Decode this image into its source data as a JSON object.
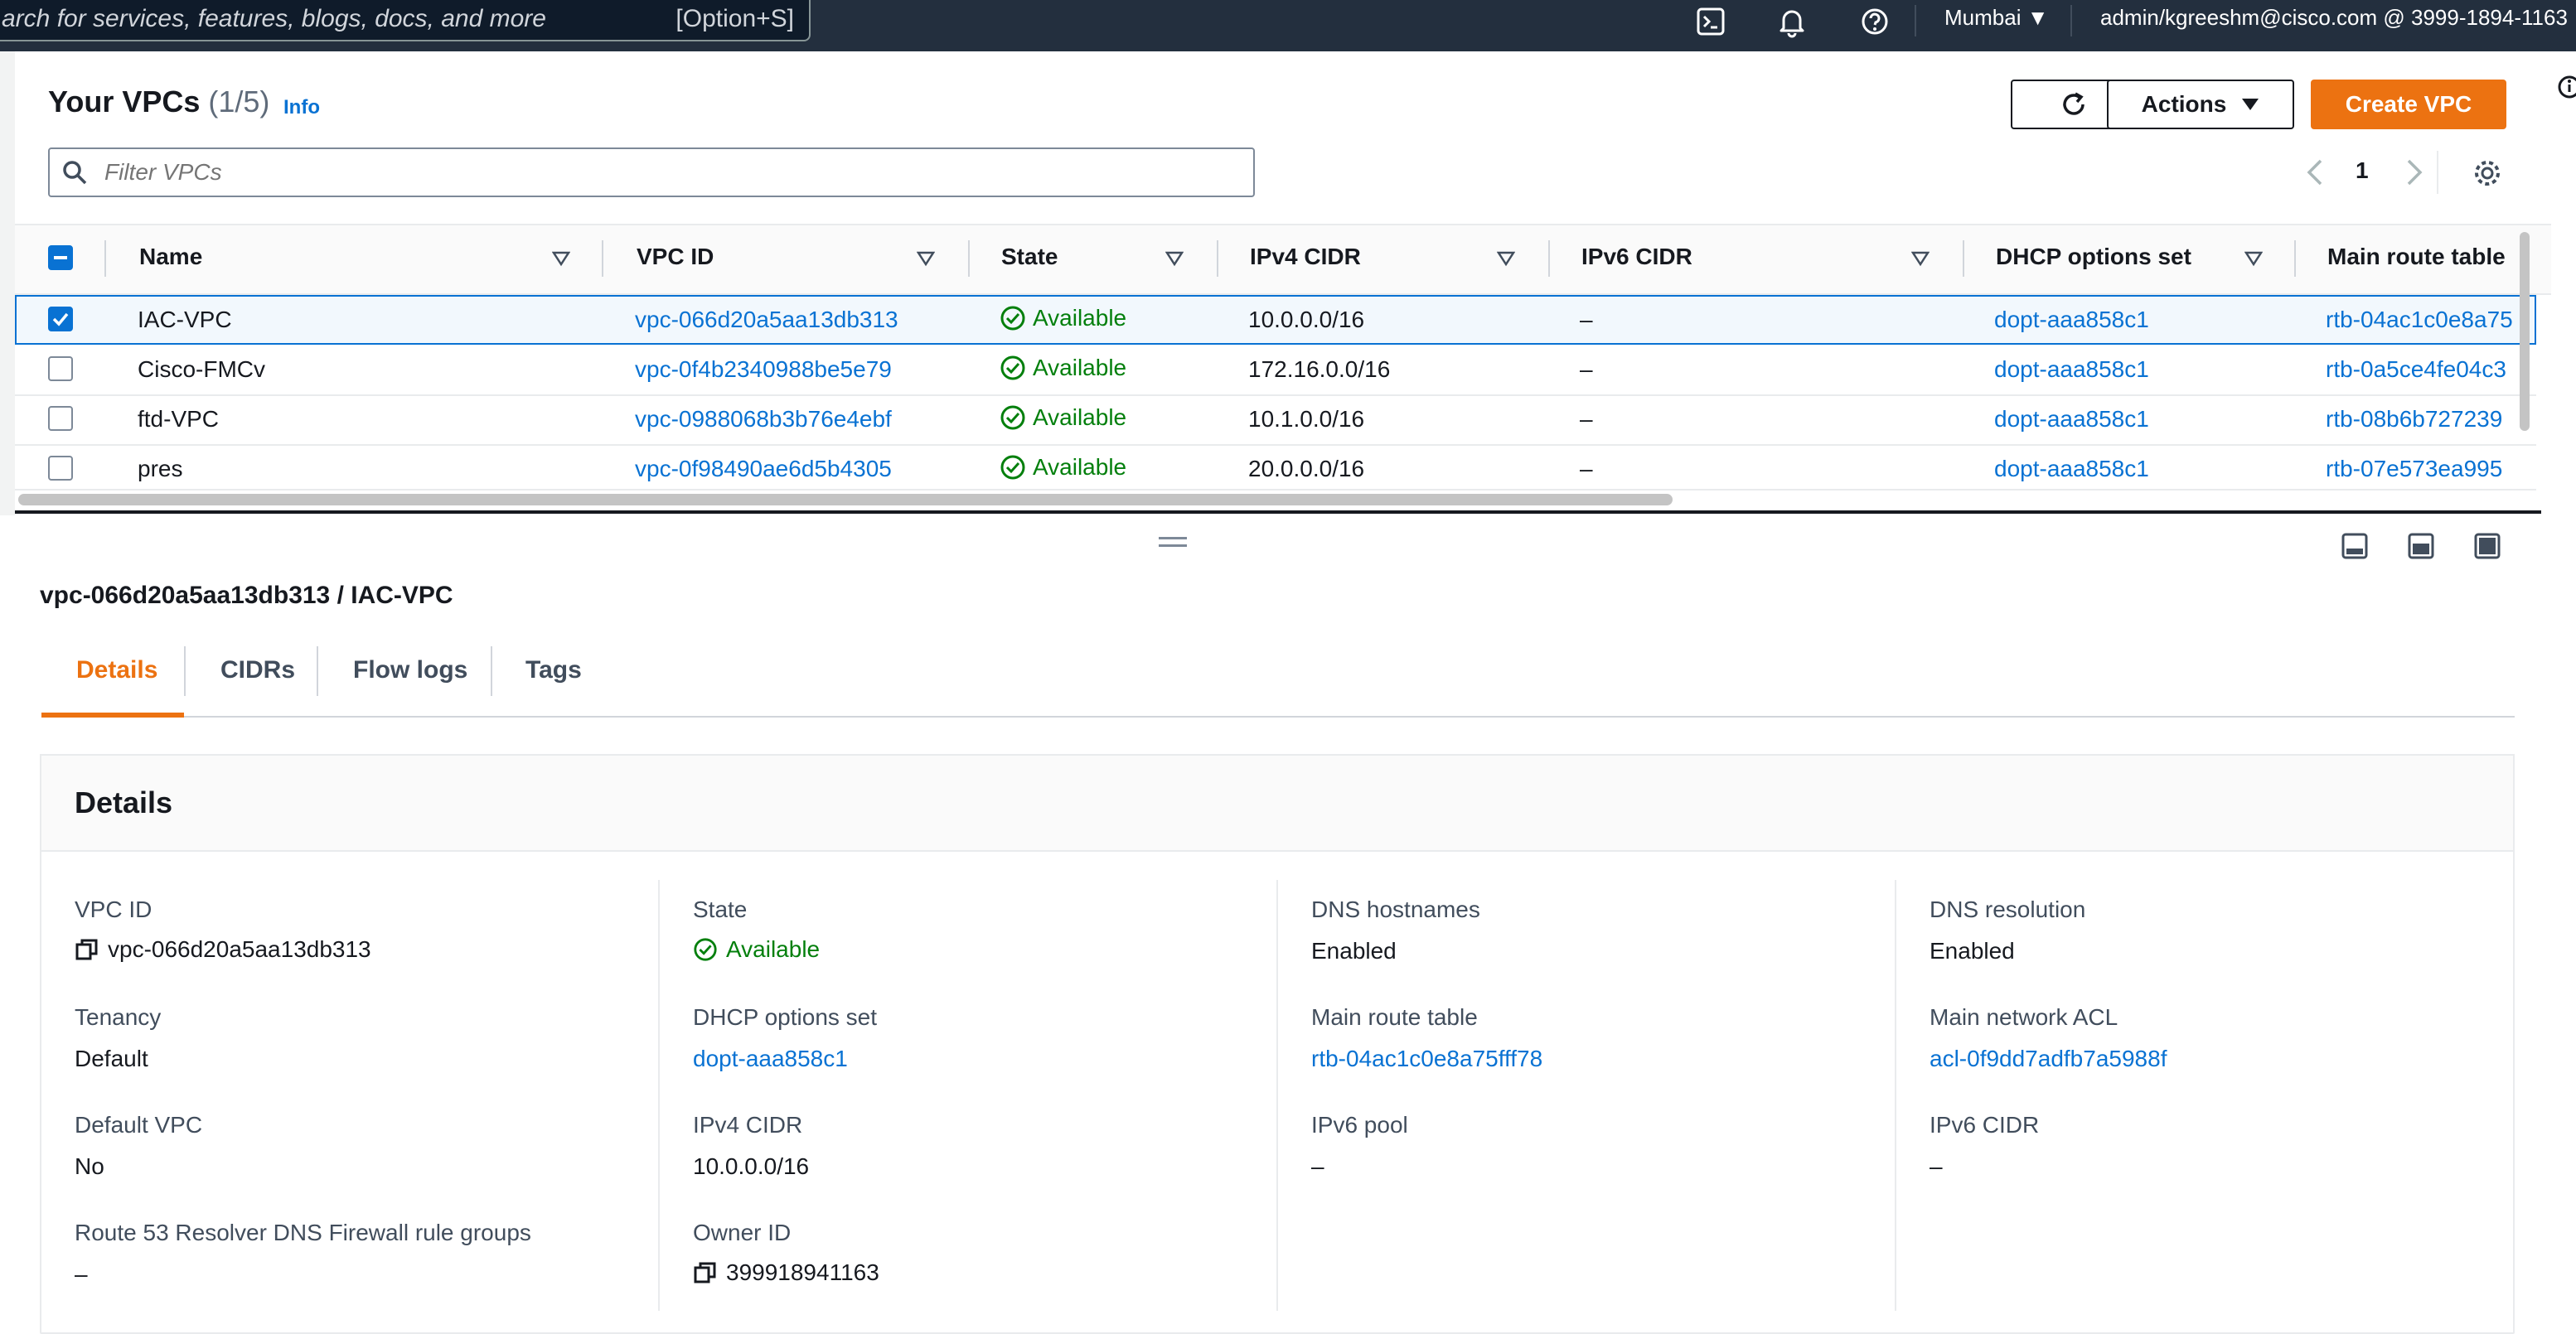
{
  "topbar": {
    "search_placeholder": "arch for services, features, blogs, docs, and more",
    "search_shortcut": "[Option+S]",
    "region": "Mumbai",
    "account": "admin/kgreeshm@cisco.com @ 3999-1894-1163"
  },
  "list": {
    "title": "Your VPCs",
    "count": "(1/5)",
    "info": "Info",
    "actions_label": "Actions",
    "create_label": "Create VPC",
    "filter_placeholder": "Filter VPCs",
    "page": "1",
    "columns": [
      "Name",
      "VPC ID",
      "State",
      "IPv4 CIDR",
      "IPv6 CIDR",
      "DHCP options set",
      "Main route table"
    ],
    "rows": [
      {
        "name": "IAC-VPC",
        "vpc_id": "vpc-066d20a5aa13db313",
        "state": "Available",
        "ipv4": "10.0.0.0/16",
        "ipv6": "–",
        "dhcp": "dopt-aaa858c1",
        "route": "rtb-04ac1c0e8a75"
      },
      {
        "name": "Cisco-FMCv",
        "vpc_id": "vpc-0f4b2340988be5e79",
        "state": "Available",
        "ipv4": "172.16.0.0/16",
        "ipv6": "–",
        "dhcp": "dopt-aaa858c1",
        "route": "rtb-0a5ce4fe04c3"
      },
      {
        "name": "ftd-VPC",
        "vpc_id": "vpc-0988068b3b76e4ebf",
        "state": "Available",
        "ipv4": "10.1.0.0/16",
        "ipv6": "–",
        "dhcp": "dopt-aaa858c1",
        "route": "rtb-08b6b727239"
      },
      {
        "name": "pres",
        "vpc_id": "vpc-0f98490ae6d5b4305",
        "state": "Available",
        "ipv4": "20.0.0.0/16",
        "ipv6": "–",
        "dhcp": "dopt-aaa858c1",
        "route": "rtb-07e573ea995"
      }
    ]
  },
  "detail": {
    "title": "vpc-066d20a5aa13db313 / IAC-VPC",
    "tabs": [
      "Details",
      "CIDRs",
      "Flow logs",
      "Tags"
    ],
    "section_heading": "Details",
    "fields": {
      "vpc_id_label": "VPC ID",
      "vpc_id": "vpc-066d20a5aa13db313",
      "tenancy_label": "Tenancy",
      "tenancy": "Default",
      "default_vpc_label": "Default VPC",
      "default_vpc": "No",
      "route53_label": "Route 53 Resolver DNS Firewall rule groups",
      "route53": "–",
      "state_label": "State",
      "state": "Available",
      "dhcp_label": "DHCP options set",
      "dhcp": "dopt-aaa858c1",
      "ipv4_label": "IPv4 CIDR",
      "ipv4": "10.0.0.0/16",
      "owner_label": "Owner ID",
      "owner": "399918941163",
      "dns_hostnames_label": "DNS hostnames",
      "dns_hostnames": "Enabled",
      "main_route_label": "Main route table",
      "main_route": "rtb-04ac1c0e8a75fff78",
      "ipv6_pool_label": "IPv6 pool",
      "ipv6_pool": "–",
      "dns_resolution_label": "DNS resolution",
      "dns_resolution": "Enabled",
      "acl_label": "Main network ACL",
      "acl": "acl-0f9dd7adfb7a5988f",
      "ipv6_cidr_label": "IPv6 CIDR",
      "ipv6_cidr": "–"
    }
  }
}
